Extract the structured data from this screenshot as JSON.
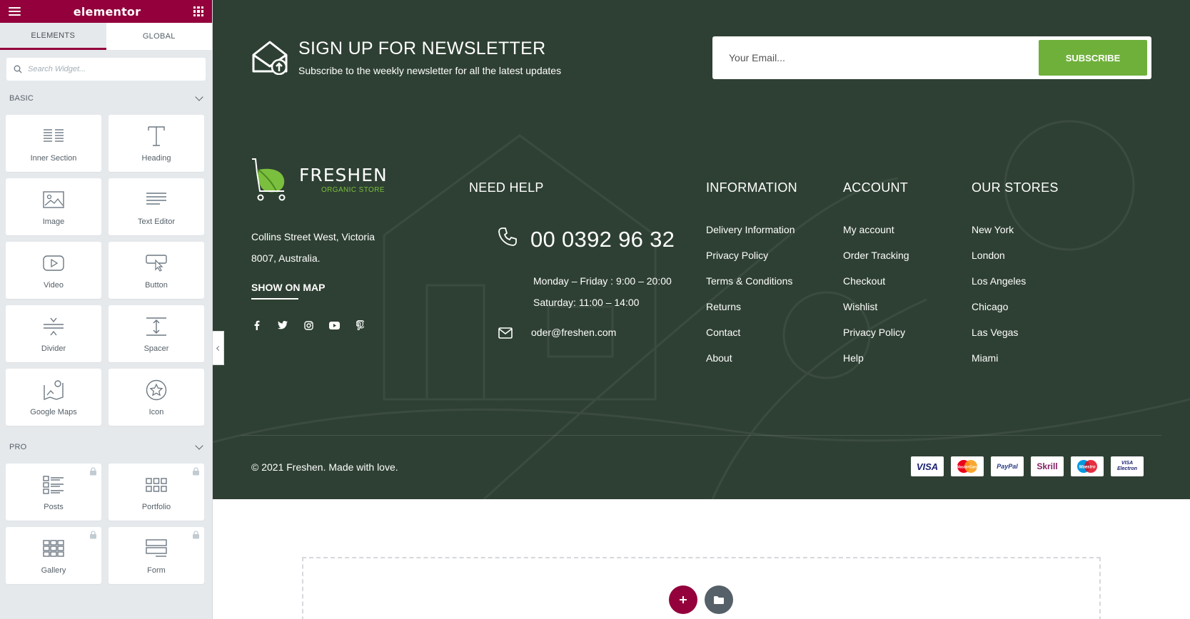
{
  "editor": {
    "brand": "elementor",
    "tabs": [
      "ELEMENTS",
      "GLOBAL"
    ],
    "search_placeholder": "Search Widget...",
    "categories": {
      "basic": "BASIC",
      "pro": "PRO"
    },
    "basic_widgets": [
      "Inner Section",
      "Heading",
      "Image",
      "Text Editor",
      "Video",
      "Button",
      "Divider",
      "Spacer",
      "Google Maps",
      "Icon"
    ],
    "pro_widgets": [
      "Posts",
      "Portfolio",
      "Gallery",
      "Form"
    ],
    "accent_color": "#93003c"
  },
  "newsletter": {
    "title": "SIGN UP FOR NEWSLETTER",
    "subtitle": "Subscribe to the weekly newsletter for all the latest updates",
    "email_placeholder": "Your Email...",
    "button": "SUBSCRIBE",
    "button_color": "#6fb03b"
  },
  "brand": {
    "name": "FRESHEN",
    "tagline": "ORGANIC STORE",
    "address_line1": "Collins Street West, Victoria",
    "address_line2": "8007, Australia.",
    "map_link": "SHOW ON MAP",
    "socials": [
      "facebook-icon",
      "twitter-icon",
      "instagram-icon",
      "youtube-icon",
      "pinterest-icon"
    ]
  },
  "help": {
    "title": "NEED HELP",
    "phone": "00 0392 96 32",
    "hours_1": "Monday – Friday : 9:00 – 20:00",
    "hours_2": "Saturday: 11:00 – 14:00",
    "email": "oder@freshen.com"
  },
  "columns": {
    "information": {
      "title": "INFORMATION",
      "links": [
        "Delivery Information",
        "Privacy Policy",
        "Terms & Conditions",
        "Returns",
        "Contact",
        "About"
      ]
    },
    "account": {
      "title": "ACCOUNT",
      "links": [
        "My account",
        "Order Tracking",
        "Checkout",
        "Wishlist",
        "Privacy Policy",
        "Help"
      ]
    },
    "stores": {
      "title": "OUR STORES",
      "links": [
        "New York",
        "London",
        "Los Angeles",
        "Chicago",
        "Las Vegas",
        "Miami"
      ]
    }
  },
  "bottom": {
    "copyright": "© 2021 Freshen. Made with love.",
    "payments": [
      "VISA",
      "MasterCard",
      "PayPal",
      "Skrill",
      "Maestro",
      "VISA Electron"
    ]
  },
  "footer_bg": "#2e4033"
}
